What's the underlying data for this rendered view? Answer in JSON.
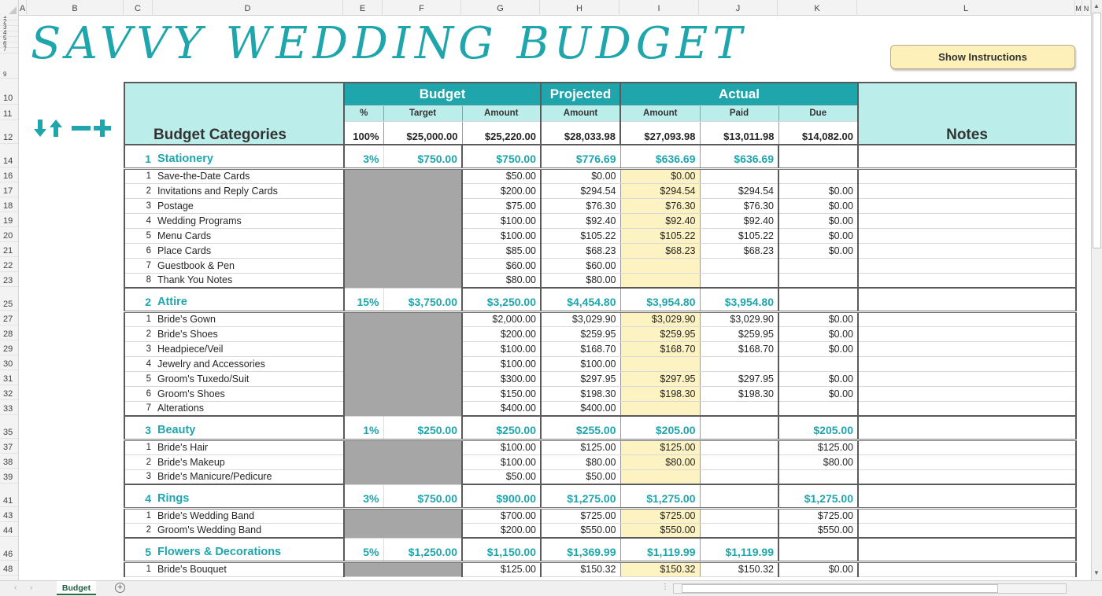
{
  "app": {
    "sheet_tabs": [
      "Budget"
    ],
    "active_tab": "Budget"
  },
  "columns": [
    "A",
    "B",
    "C",
    "D",
    "E",
    "F",
    "G",
    "H",
    "I",
    "J",
    "K",
    "L",
    "M",
    "N"
  ],
  "rows_visible": [
    "1",
    "2",
    "3",
    "4",
    "5",
    "6",
    "7",
    "9",
    "10",
    "11",
    "12",
    "14",
    "16",
    "17",
    "18",
    "19",
    "20",
    "21",
    "22",
    "23",
    "25",
    "27",
    "28",
    "29",
    "30",
    "31",
    "32",
    "33",
    "35",
    "37",
    "38",
    "39",
    "41",
    "43",
    "44",
    "46",
    "48"
  ],
  "title": "SAVVY WEDDING BUDGET",
  "toolbar": {
    "show_instructions_label": "Show Instructions",
    "icons": [
      "arrow-down-icon",
      "arrow-up-icon",
      "minus-icon",
      "plus-icon"
    ],
    "accent_color": "#1fa6ad"
  },
  "header": {
    "budget_categories": "Budget Categories",
    "notes": "Notes",
    "groups": {
      "budget": "Budget",
      "projected": "Projected",
      "actual": "Actual"
    },
    "sub": {
      "pct": "%",
      "target": "Target",
      "budget_amount": "Amount",
      "projected_amount": "Amount",
      "actual_amount": "Amount",
      "paid": "Paid",
      "due": "Due"
    },
    "totals": {
      "pct": "100%",
      "target": "$25,000.00",
      "budget_amount": "$25,220.00",
      "projected_amount": "$28,033.98",
      "actual_amount": "$27,093.98",
      "paid": "$13,011.98",
      "due": "$14,082.00"
    }
  },
  "categories": [
    {
      "num": "1",
      "name": "Stationery",
      "pct": "3%",
      "target": "$750.00",
      "amount": "$750.00",
      "projected": "$776.69",
      "actual": "$636.69",
      "paid": "$636.69",
      "due": "",
      "items": [
        {
          "num": "1",
          "name": "Save-the-Date Cards",
          "amount": "$50.00",
          "projected": "$0.00",
          "actual": "$0.00",
          "paid": "",
          "due": ""
        },
        {
          "num": "2",
          "name": "Invitations and Reply Cards",
          "amount": "$200.00",
          "projected": "$294.54",
          "actual": "$294.54",
          "paid": "$294.54",
          "due": "$0.00"
        },
        {
          "num": "3",
          "name": "Postage",
          "amount": "$75.00",
          "projected": "$76.30",
          "actual": "$76.30",
          "paid": "$76.30",
          "due": "$0.00"
        },
        {
          "num": "4",
          "name": "Wedding Programs",
          "amount": "$100.00",
          "projected": "$92.40",
          "actual": "$92.40",
          "paid": "$92.40",
          "due": "$0.00"
        },
        {
          "num": "5",
          "name": "Menu Cards",
          "amount": "$100.00",
          "projected": "$105.22",
          "actual": "$105.22",
          "paid": "$105.22",
          "due": "$0.00"
        },
        {
          "num": "6",
          "name": "Place Cards",
          "amount": "$85.00",
          "projected": "$68.23",
          "actual": "$68.23",
          "paid": "$68.23",
          "due": "$0.00"
        },
        {
          "num": "7",
          "name": "Guestbook & Pen",
          "amount": "$60.00",
          "projected": "$60.00",
          "actual": "",
          "paid": "",
          "due": ""
        },
        {
          "num": "8",
          "name": "Thank You Notes",
          "amount": "$80.00",
          "projected": "$80.00",
          "actual": "",
          "paid": "",
          "due": ""
        }
      ]
    },
    {
      "num": "2",
      "name": "Attire",
      "pct": "15%",
      "target": "$3,750.00",
      "amount": "$3,250.00",
      "projected": "$4,454.80",
      "actual": "$3,954.80",
      "paid": "$3,954.80",
      "due": "",
      "items": [
        {
          "num": "1",
          "name": "Bride's Gown",
          "amount": "$2,000.00",
          "projected": "$3,029.90",
          "actual": "$3,029.90",
          "paid": "$3,029.90",
          "due": "$0.00"
        },
        {
          "num": "2",
          "name": "Bride's Shoes",
          "amount": "$200.00",
          "projected": "$259.95",
          "actual": "$259.95",
          "paid": "$259.95",
          "due": "$0.00"
        },
        {
          "num": "3",
          "name": "Headpiece/Veil",
          "amount": "$100.00",
          "projected": "$168.70",
          "actual": "$168.70",
          "paid": "$168.70",
          "due": "$0.00"
        },
        {
          "num": "4",
          "name": "Jewelry and Accessories",
          "amount": "$100.00",
          "projected": "$100.00",
          "actual": "",
          "paid": "",
          "due": ""
        },
        {
          "num": "5",
          "name": "Groom's Tuxedo/Suit",
          "amount": "$300.00",
          "projected": "$297.95",
          "actual": "$297.95",
          "paid": "$297.95",
          "due": "$0.00"
        },
        {
          "num": "6",
          "name": "Groom's Shoes",
          "amount": "$150.00",
          "projected": "$198.30",
          "actual": "$198.30",
          "paid": "$198.30",
          "due": "$0.00"
        },
        {
          "num": "7",
          "name": "Alterations",
          "amount": "$400.00",
          "projected": "$400.00",
          "actual": "",
          "paid": "",
          "due": ""
        }
      ]
    },
    {
      "num": "3",
      "name": "Beauty",
      "pct": "1%",
      "target": "$250.00",
      "amount": "$250.00",
      "projected": "$255.00",
      "actual": "$205.00",
      "paid": "",
      "due": "$205.00",
      "items": [
        {
          "num": "1",
          "name": "Bride's Hair",
          "amount": "$100.00",
          "projected": "$125.00",
          "actual": "$125.00",
          "paid": "",
          "due": "$125.00"
        },
        {
          "num": "2",
          "name": "Bride's Makeup",
          "amount": "$100.00",
          "projected": "$80.00",
          "actual": "$80.00",
          "paid": "",
          "due": "$80.00"
        },
        {
          "num": "3",
          "name": "Bride's Manicure/Pedicure",
          "amount": "$50.00",
          "projected": "$50.00",
          "actual": "",
          "paid": "",
          "due": ""
        }
      ]
    },
    {
      "num": "4",
      "name": "Rings",
      "pct": "3%",
      "target": "$750.00",
      "amount": "$900.00",
      "projected": "$1,275.00",
      "actual": "$1,275.00",
      "paid": "",
      "due": "$1,275.00",
      "items": [
        {
          "num": "1",
          "name": "Bride's Wedding Band",
          "amount": "$700.00",
          "projected": "$725.00",
          "actual": "$725.00",
          "paid": "",
          "due": "$725.00"
        },
        {
          "num": "2",
          "name": "Groom's Wedding Band",
          "amount": "$200.00",
          "projected": "$550.00",
          "actual": "$550.00",
          "paid": "",
          "due": "$550.00"
        }
      ]
    },
    {
      "num": "5",
      "name": "Flowers & Decorations",
      "pct": "5%",
      "target": "$1,250.00",
      "amount": "$1,150.00",
      "projected": "$1,369.99",
      "actual": "$1,119.99",
      "paid": "$1,119.99",
      "due": "",
      "items": [
        {
          "num": "1",
          "name": "Bride's Bouquet",
          "amount": "$125.00",
          "projected": "$150.32",
          "actual": "$150.32",
          "paid": "$150.32",
          "due": "$0.00"
        }
      ]
    }
  ]
}
